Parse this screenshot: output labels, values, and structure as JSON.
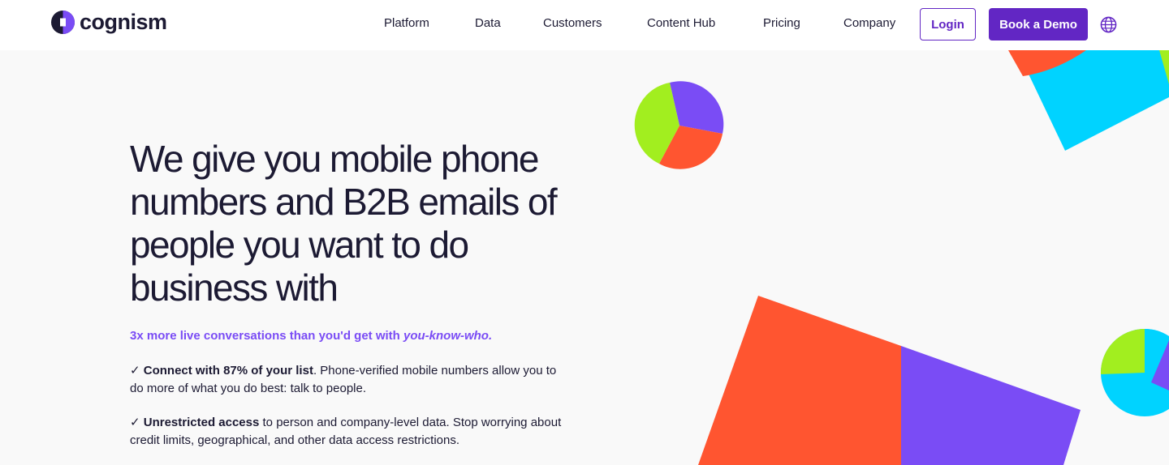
{
  "header": {
    "logo_text": "cognism",
    "nav": [
      "Platform",
      "Data",
      "Customers",
      "Content Hub",
      "Pricing",
      "Company"
    ],
    "login_label": "Login",
    "demo_label": "Book a Demo",
    "icons": {
      "logo": "cognism-logo-icon",
      "language": "globe-icon"
    }
  },
  "hero": {
    "title": "We give you mobile phone numbers and B2B emails of people you want to do business with",
    "tagline_main": "3x more live conversations than you'd get with ",
    "tagline_emphasis": "you-know-who.",
    "bullets": [
      {
        "check": "✓",
        "strong": "Connect with 87% of your list",
        "text": ". Phone-verified mobile numbers allow you to do more of what you do best: talk to people."
      },
      {
        "check": "✓",
        "strong": "Unrestricted access",
        "text": " to person and company-level data. Stop worrying about credit limits, geographical, and other data access restrictions."
      }
    ]
  },
  "colors": {
    "brand_purple": "#6226c4",
    "accent_violet": "#7a4cf5",
    "shape_orange": "#ff5530",
    "shape_lime": "#a2ee1f",
    "shape_cyan": "#00d3ff",
    "text_dark": "#1c1a33",
    "background": "#f9f9f9"
  }
}
